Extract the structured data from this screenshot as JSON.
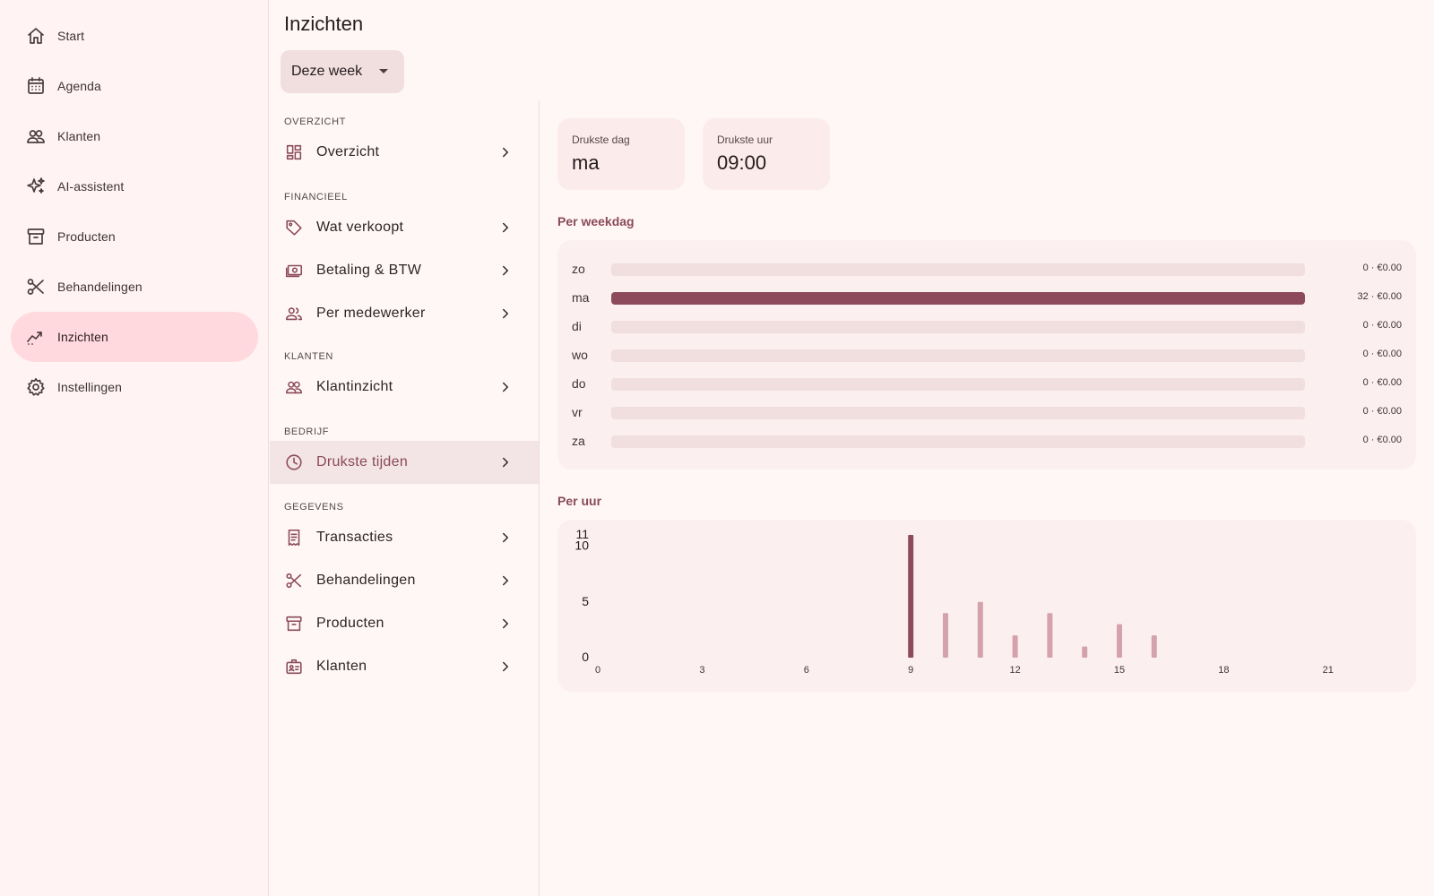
{
  "nav": {
    "items": [
      {
        "label": "Start",
        "icon": "home-icon",
        "active": false
      },
      {
        "label": "Agenda",
        "icon": "calendar-icon",
        "active": false
      },
      {
        "label": "Klanten",
        "icon": "people-icon",
        "active": false
      },
      {
        "label": "AI-assistent",
        "icon": "sparkle-icon",
        "active": false
      },
      {
        "label": "Producten",
        "icon": "archive-box-icon",
        "active": false
      },
      {
        "label": "Behandelingen",
        "icon": "scissors-icon",
        "active": false
      },
      {
        "label": "Inzichten",
        "icon": "trending-chart-icon",
        "active": true
      },
      {
        "label": "Instellingen",
        "icon": "gear-icon",
        "active": false
      }
    ]
  },
  "header": {
    "title": "Inzichten",
    "range": "Deze week"
  },
  "menu": {
    "sections": [
      {
        "title": "Overzicht",
        "items": [
          {
            "label": "Overzicht",
            "icon": "dashboard-icon"
          }
        ]
      },
      {
        "title": "Financieel",
        "items": [
          {
            "label": "Wat verkoopt",
            "icon": "tag-icon"
          },
          {
            "label": "Betaling & BTW",
            "icon": "cash-icon"
          },
          {
            "label": "Per medewerker",
            "icon": "group-icon"
          }
        ]
      },
      {
        "title": "Klanten",
        "items": [
          {
            "label": "Klantinzicht",
            "icon": "people-icon"
          }
        ]
      },
      {
        "title": "Bedrijf",
        "items": [
          {
            "label": "Drukste tijden",
            "icon": "clock-icon",
            "active": true
          }
        ]
      },
      {
        "title": "Gegevens",
        "items": [
          {
            "label": "Transacties",
            "icon": "receipt-icon"
          },
          {
            "label": "Behandelingen",
            "icon": "scissors-icon"
          },
          {
            "label": "Producten",
            "icon": "archive-box-icon"
          },
          {
            "label": "Klanten",
            "icon": "id-badge-icon"
          }
        ]
      }
    ]
  },
  "stats": [
    {
      "label": "Drukste dag",
      "value": "ma"
    },
    {
      "label": "Drukste uur",
      "value": "09:00"
    }
  ],
  "weekday": {
    "title": "Per weekdag",
    "rows": [
      {
        "day": "zo",
        "count": 0,
        "text": "0 · €0.00"
      },
      {
        "day": "ma",
        "count": 32,
        "text": "32 · €0.00"
      },
      {
        "day": "di",
        "count": 0,
        "text": "0 · €0.00"
      },
      {
        "day": "wo",
        "count": 0,
        "text": "0 · €0.00"
      },
      {
        "day": "do",
        "count": 0,
        "text": "0 · €0.00"
      },
      {
        "day": "vr",
        "count": 0,
        "text": "0 · €0.00"
      },
      {
        "day": "za",
        "count": 0,
        "text": "0 · €0.00"
      }
    ]
  },
  "hourly": {
    "title": "Per uur"
  },
  "colors": {
    "accent": "#8c4a5a",
    "accent_light": "#d4a2ac",
    "track": "#f1dedf"
  },
  "chart_data": {
    "type": "bar",
    "x": [
      9,
      10,
      11,
      12,
      13,
      14,
      15,
      16
    ],
    "values": [
      11,
      4,
      5,
      2,
      4,
      1,
      3,
      2
    ],
    "xticks": [
      0,
      3,
      6,
      9,
      12,
      15,
      18,
      21
    ],
    "yticks": [
      0,
      5,
      10,
      11
    ],
    "xlim": [
      0,
      23
    ],
    "ylim": [
      0,
      11
    ],
    "highlight_x": 9,
    "grid": false
  }
}
